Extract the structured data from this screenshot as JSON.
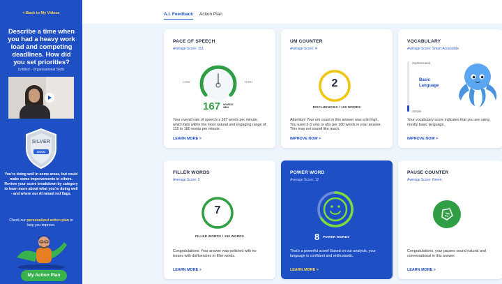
{
  "sidebar": {
    "back_link": "< Back to My Videos",
    "question": "Describe a time when you had a heavy work load and competing deadlines. How did you set priorities?",
    "subtitle": "Untitled - Organizational Skills",
    "badge_label": "SILVER",
    "badge_sub": "GOOD",
    "feedback": "You're doing well in some areas, but could make some improvements in others. Review your score breakdown by category to learn more about what you're doing well - and where our AI raised red flags.",
    "plan_prefix": "Check our ",
    "plan_highlight": "personalized action plan",
    "plan_suffix": " to help you improve.",
    "action_button": "My Action Plan"
  },
  "tabs": [
    {
      "label": "A.I. Feedback",
      "active": true
    },
    {
      "label": "Action Plan",
      "active": false
    }
  ],
  "cards": {
    "pace": {
      "title": "PACE OF SPEECH",
      "average": "Average Score: 151",
      "gauge_low": "LOW",
      "gauge_high": "HIGH",
      "value": "167",
      "unit_line1": "WORDS",
      "unit_line2": "/MIN",
      "description": "Your overall rate of speech is 167 words per minute, which falls within the most natural and engaging range of 115 to 180 words per minute.",
      "link": "LEARN MORE >"
    },
    "um": {
      "title": "UM COUNTER",
      "average": "Average Score: 4",
      "value": "2",
      "caption": "DISFLUENCIES / 100 WORDS",
      "description": "Attention! Your um count in this answer was a bit high. You used 2-3 ums or uhs per 100 words in your answer. This may not sound like much.",
      "link": "IMPROVE NOW >"
    },
    "vocabulary": {
      "title": "VOCABULARY",
      "average": "Average Score: Smart Accessible",
      "scale_top": "Sophisticated",
      "level": "Basic Language",
      "scale_bottom": "Simple",
      "level_fraction": 0.12,
      "description": "Your vocabulary score indicates that you are using mostly basic language.",
      "link": "IMPROVE NOW >"
    },
    "filler": {
      "title": "FILLER WORDS",
      "average": "Average Score: 2",
      "value": "7",
      "caption": "FILLER WORDS / 100 WORDS",
      "description": "Congratulations: Your answer was polished with no issues with disfluencies or filler words.",
      "link": "LEARN MORE >"
    },
    "power": {
      "title": "POWER WORD",
      "average": "Average Score: 12",
      "value": "8",
      "caption": "POWER WORDS",
      "description": "That's a powerful score! Based on our analysis, your language is confident and enthusiastic.",
      "link": "LEARN MORE >"
    },
    "pause": {
      "title": "PAUSE COUNTER",
      "average": "Average Score: Green",
      "description": "Congratulations, your pauses sound natural and conversational in this answer.",
      "link": "LEARN MORE >"
    }
  },
  "colors": {
    "brand_blue": "#1f4fc4",
    "green": "#2f9e44",
    "yellow": "#f1c40f",
    "accent_yellow": "#ffd84a"
  }
}
